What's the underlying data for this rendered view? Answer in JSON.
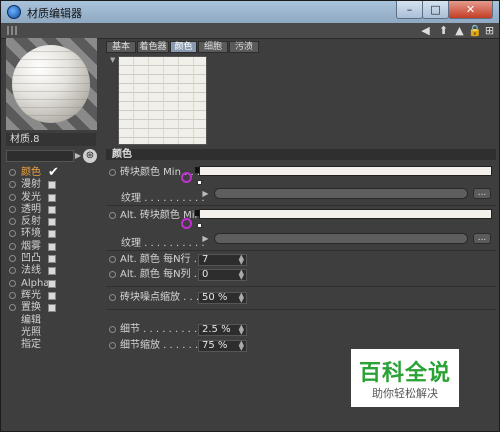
{
  "window": {
    "title": "材质编辑器"
  },
  "window_buttons": {
    "minimize": "–",
    "maximize": "□",
    "close": "✕"
  },
  "toolbar": {
    "icons": [
      "arrow-left-icon",
      "arrow-up-icon",
      "arrow-triangle-icon",
      "lock-icon",
      "expand-icon"
    ]
  },
  "material": {
    "name": "材质.8"
  },
  "channels": [
    {
      "label": "颜色",
      "checked": true,
      "active": true
    },
    {
      "label": "漫射",
      "checked": false
    },
    {
      "label": "发光",
      "checked": false
    },
    {
      "label": "透明",
      "checked": false
    },
    {
      "label": "反射",
      "checked": false
    },
    {
      "label": "环境",
      "checked": false
    },
    {
      "label": "烟雾",
      "checked": false
    },
    {
      "label": "凹凸",
      "checked": false
    },
    {
      "label": "法线",
      "checked": false
    },
    {
      "label": "Alpha",
      "checked": false
    },
    {
      "label": "辉光",
      "checked": false
    },
    {
      "label": "置换",
      "checked": false
    }
  ],
  "extra_items": [
    "编辑",
    "光照",
    "指定"
  ],
  "tabs": [
    "基本",
    "着色器",
    "颜色",
    "细胞",
    "污渍"
  ],
  "active_tab": "颜色",
  "section_title": "颜色",
  "params": {
    "brick_color_min": "砖块颜色 Min . . . .",
    "texture1": "纹理 . . . . . . . . . .",
    "alt_brick_color_min": "Alt. 砖块颜色 Min",
    "texture2": "纹理 . . . . . . . . . .",
    "alt_color_row": "Alt. 颜色 每N行 . . .",
    "alt_color_row_value": "7",
    "alt_color_col": "Alt. 颜色 每N列 . . .",
    "alt_color_col_value": "0",
    "brick_noise_scale": "砖块噪点缩放 . . . . .",
    "brick_noise_scale_value": "50 %",
    "detail": "细节 . . . . . . . . . . .",
    "detail_value": "2.5 %",
    "detail_scale": "细节缩放 . . . . . . . .",
    "detail_scale_value": "75 %",
    "more_button": "..."
  },
  "watermark": {
    "title": "百科全说",
    "subtitle": "助你轻松解决"
  },
  "colors": {
    "accent_active": "#f2a33a",
    "highlight_circle": "#c22fd2",
    "watermark_green": "#2aa235"
  }
}
